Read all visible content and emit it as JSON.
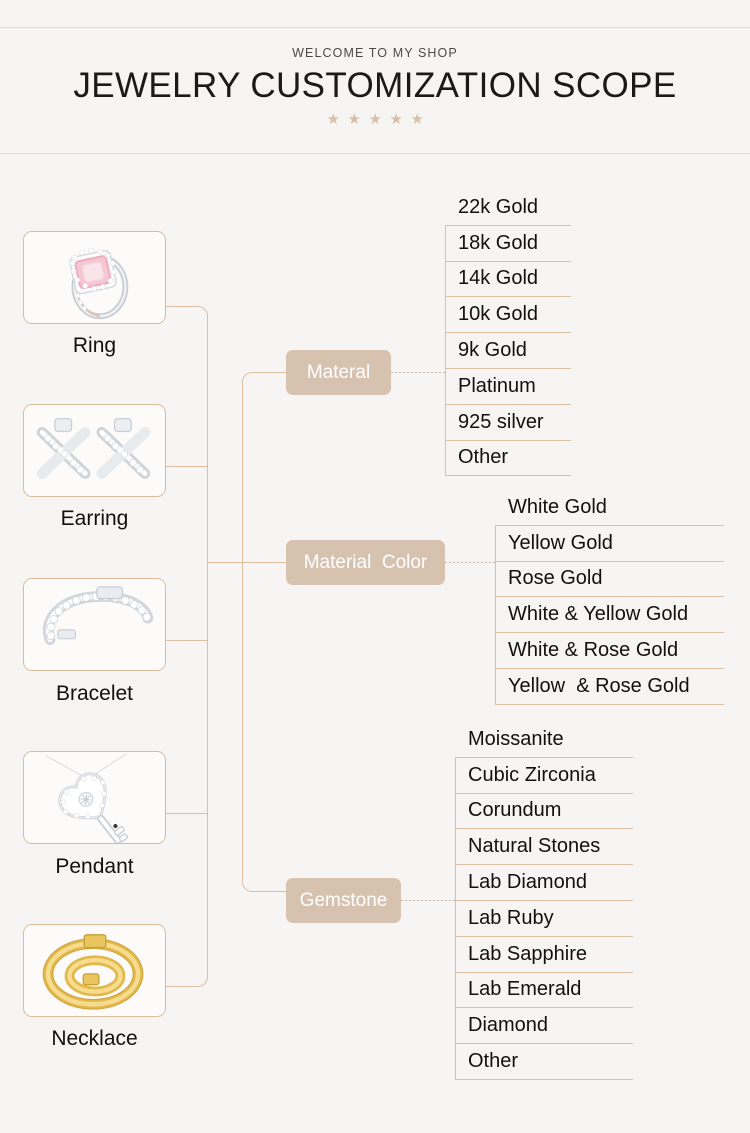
{
  "header": {
    "welcome": "WELCOME TO MY SHOP",
    "title": "JEWELRY CUSTOMIZATION SCOPE",
    "star_glyph": "★",
    "star_count": 5,
    "star_color": "#d8bfa6"
  },
  "colors": {
    "background": "#f6f5f3",
    "line": "#dcbfa1",
    "badge_bg": "#d6c2af",
    "badge_text": "#ffffff",
    "card_border": "#d9bc9b",
    "text": "#111111"
  },
  "products": [
    {
      "label": "Ring",
      "icon": "ring-image"
    },
    {
      "label": "Earring",
      "icon": "earring-image"
    },
    {
      "label": "Bracelet",
      "icon": "bracelet-image"
    },
    {
      "label": "Pendant",
      "icon": "pendant-image"
    },
    {
      "label": "Necklace",
      "icon": "necklace-image"
    }
  ],
  "categories": [
    {
      "label": "Materal",
      "options": [
        "22k Gold",
        "18k Gold",
        "14k Gold",
        "10k Gold",
        "9k Gold",
        "Platinum",
        "925 silver",
        "Other"
      ]
    },
    {
      "label": "Material  Color",
      "options": [
        "White Gold",
        "Yellow Gold",
        "Rose Gold",
        "White & Yellow Gold",
        "White & Rose Gold",
        "Yellow  & Rose Gold"
      ]
    },
    {
      "label": "Gemstone",
      "options": [
        "Moissanite",
        "Cubic Zirconia",
        "Corundum",
        "Natural Stones",
        "Lab Diamond",
        "Lab Ruby",
        "Lab Sapphire",
        "Lab Emerald",
        "Diamond",
        "Other"
      ]
    }
  ]
}
